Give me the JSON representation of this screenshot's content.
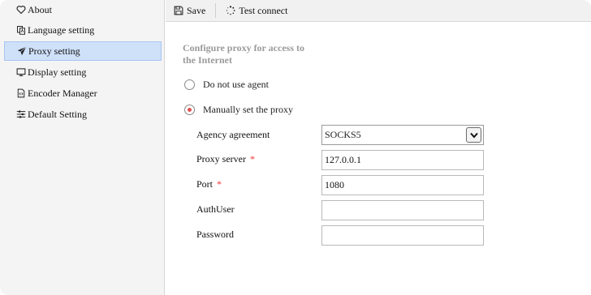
{
  "sidebar": {
    "items": [
      {
        "label": "About",
        "icon": "heart-icon"
      },
      {
        "label": "Language setting",
        "icon": "language-icon"
      },
      {
        "label": "Proxy setting",
        "icon": "paper-plane-icon",
        "active": true
      },
      {
        "label": "Display setting",
        "icon": "monitor-icon"
      },
      {
        "label": "Encoder Manager",
        "icon": "encoder-file-icon"
      },
      {
        "label": "Default Setting",
        "icon": "sliders-icon"
      }
    ]
  },
  "toolbar": {
    "save_label": "Save",
    "test_connect_label": "Test connect"
  },
  "proxy": {
    "section_title": "Configure proxy for access to the Internet",
    "option_no_agent": "Do not use agent",
    "option_manual": "Manually set the proxy",
    "selected_option": "manual",
    "agency_label": "Agency agreement",
    "agency_value": "SOCKS5",
    "server_label": "Proxy server",
    "server_value": "127.0.0.1",
    "port_label": "Port",
    "port_value": "1080",
    "authuser_label": "AuthUser",
    "authuser_value": "",
    "password_label": "Password",
    "password_value": "",
    "required_mark": "*"
  },
  "colors": {
    "active_item_bg": "#cfe0f9",
    "required": "#e33333",
    "radio_dot": "#e05252"
  }
}
